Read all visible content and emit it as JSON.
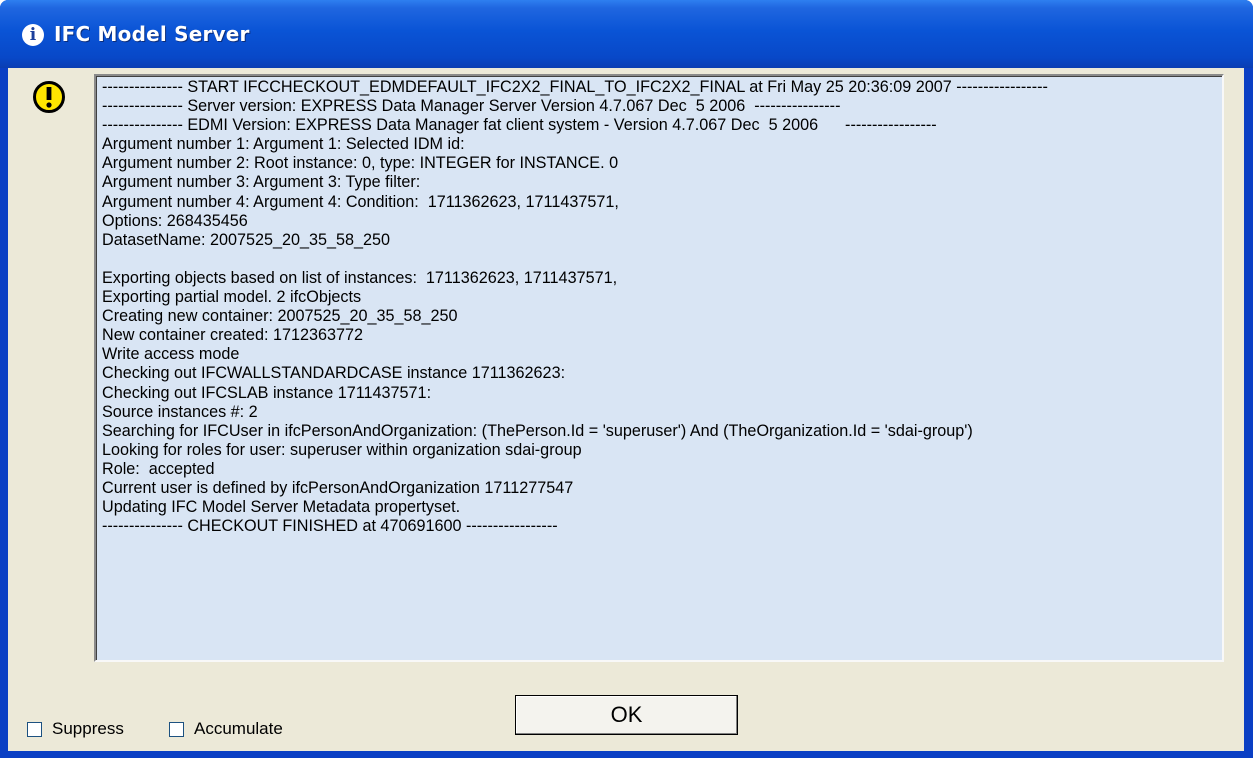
{
  "window": {
    "title": "IFC Model Server",
    "title_icon": "info-icon"
  },
  "dialog": {
    "icon": "warning-icon",
    "log_lines": [
      "--------------- START IFCCHECKOUT_EDMDEFAULT_IFC2X2_FINAL_TO_IFC2X2_FINAL at Fri May 25 20:36:09 2007 -----------------",
      "--------------- Server version: EXPRESS Data Manager Server Version 4.7.067 Dec  5 2006  ----------------",
      "--------------- EDMI Version: EXPRESS Data Manager fat client system - Version 4.7.067 Dec  5 2006      -----------------",
      "Argument number 1: Argument 1: Selected IDM id:",
      "Argument number 2: Root instance: 0, type: INTEGER for INSTANCE. 0",
      "Argument number 3: Argument 3: Type filter:",
      "Argument number 4: Argument 4: Condition:  1711362623, 1711437571,",
      "Options: 268435456",
      "DatasetName: 2007525_20_35_58_250",
      "",
      "Exporting objects based on list of instances:  1711362623, 1711437571,",
      "Exporting partial model. 2 ifcObjects",
      "Creating new container: 2007525_20_35_58_250",
      "New container created: 1712363772",
      "Write access mode",
      "Checking out IFCWALLSTANDARDCASE instance 1711362623:",
      "Checking out IFCSLAB instance 1711437571:",
      "Source instances #: 2",
      "Searching for IFCUser in ifcPersonAndOrganization: (ThePerson.Id = 'superuser') And (TheOrganization.Id = 'sdai-group')",
      "Looking for roles for user: superuser within organization sdai-group",
      "Role:  accepted",
      "Current user is defined by ifcPersonAndOrganization 1711277547",
      "Updating IFC Model Server Metadata propertyset.",
      "--------------- CHECKOUT FINISHED at 470691600 -----------------"
    ],
    "ok_label": "OK",
    "suppress_label": "Suppress",
    "suppress_checked": false,
    "accumulate_label": "Accumulate",
    "accumulate_checked": false
  },
  "colors": {
    "titlebar": "#0a54d6",
    "client_bg": "#ece9d8",
    "log_bg": "#d9e5f4",
    "warning_yellow": "#ffe600"
  }
}
